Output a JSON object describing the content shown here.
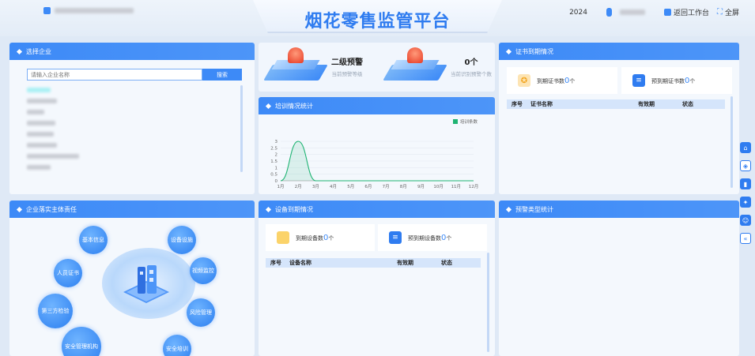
{
  "header": {
    "title": "烟花零售监管平台",
    "year": "2024",
    "back_label": "返回工作台",
    "fullscreen_label": "全屏"
  },
  "company_panel": {
    "title": "选择企业",
    "search_placeholder": "请输入企业名称",
    "search_button": "搜索"
  },
  "alerts": {
    "level_value": "二级预警",
    "level_label": "当前预警等级",
    "count_value": "0个",
    "count_label": "当前识别预警个数"
  },
  "training": {
    "title": "培训情况统计",
    "legend": "培训条数"
  },
  "chart_data": {
    "type": "area",
    "categories": [
      "1月",
      "2月",
      "3月",
      "4月",
      "5月",
      "6月",
      "7月",
      "8月",
      "9月",
      "10月",
      "11月",
      "12月"
    ],
    "series": [
      {
        "name": "培训条数",
        "values": [
          0,
          3,
          0,
          0,
          0,
          0,
          0,
          0,
          0,
          0,
          0,
          0
        ]
      }
    ],
    "yticks": [
      "0",
      "0.5",
      "1",
      "1.5",
      "2",
      "2.5",
      "3"
    ],
    "ylim": [
      0,
      3
    ],
    "color": "#1fb473"
  },
  "cert_panel": {
    "title": "证书到期情况",
    "expired_label": "到期证书数",
    "expired_value": "0",
    "expired_unit": "个",
    "pre_label": "预到期证书数",
    "pre_value": "0",
    "pre_unit": "个",
    "columns": [
      "序号",
      "证书名称",
      "有效期",
      "状态"
    ]
  },
  "responsibility_panel": {
    "title": "企业落实主体责任",
    "items": [
      "基本信息",
      "设备设施",
      "视频监控",
      "人员证书",
      "风险管理",
      "第三方检验",
      "安全管理机构",
      "安全培训"
    ]
  },
  "device_panel": {
    "title": "设备到期情况",
    "expired_label": "到期设备数",
    "expired_value": "0",
    "expired_unit": "个",
    "pre_label": "预到期设备数",
    "pre_value": "0",
    "pre_unit": "个",
    "columns": [
      "序号",
      "设备名称",
      "有效期",
      "状态"
    ]
  },
  "warning_type_panel": {
    "title": "预警类型统计"
  },
  "side_toolbar": [
    "home-icon",
    "shield-icon",
    "book-icon",
    "puzzle-icon",
    "robot-icon",
    "collapse-icon"
  ]
}
